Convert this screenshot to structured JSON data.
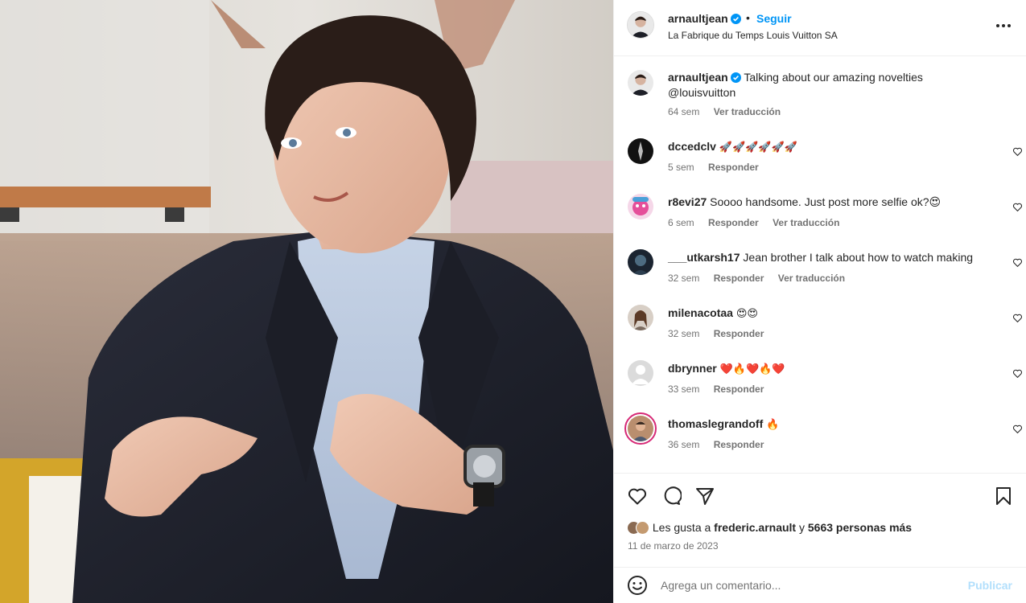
{
  "header": {
    "username": "arnaultjean",
    "separator": "•",
    "follow_label": "Seguir",
    "location": "La Fabrique du Temps Louis Vuitton SA",
    "more_icon": "more-horizontal-icon"
  },
  "caption": {
    "username": "arnaultjean",
    "text": "Talking about our amazing novelties @louisvuitton",
    "time": "64 sem",
    "translate_label": "Ver traducción"
  },
  "comments": [
    {
      "username": "dccedclv",
      "text": "🚀🚀🚀🚀🚀🚀",
      "time": "5 sem",
      "reply_label": "Responder",
      "translate_label": ""
    },
    {
      "username": "r8evi27",
      "text": "Soooo handsome. Just post more selfie ok?😍",
      "time": "6 sem",
      "reply_label": "Responder",
      "translate_label": "Ver traducción"
    },
    {
      "username": "___utkarsh17",
      "text": "Jean brother I talk about how to watch making",
      "time": "32 sem",
      "reply_label": "Responder",
      "translate_label": "Ver traducción"
    },
    {
      "username": "milenacotaa",
      "text": "😍😍",
      "time": "32 sem",
      "reply_label": "Responder",
      "translate_label": ""
    },
    {
      "username": "dbrynner",
      "text": "❤️🔥❤️🔥❤️",
      "time": "33 sem",
      "reply_label": "Responder",
      "translate_label": ""
    },
    {
      "username": "thomaslegrandoff",
      "text": "🔥",
      "time": "36 sem",
      "reply_label": "Responder",
      "translate_label": ""
    }
  ],
  "likes": {
    "prefix": "Les gusta a",
    "user": "frederic.arnault",
    "conjunction": "y",
    "others": "5663 personas más"
  },
  "date": "11 de marzo de 2023",
  "add_comment": {
    "placeholder": "Agrega un comentario...",
    "publish_label": "Publicar"
  },
  "colors": {
    "accent": "#0095f6",
    "publish_disabled": "#b2dffc",
    "secondary_text": "#737373",
    "divider": "#efefef"
  }
}
